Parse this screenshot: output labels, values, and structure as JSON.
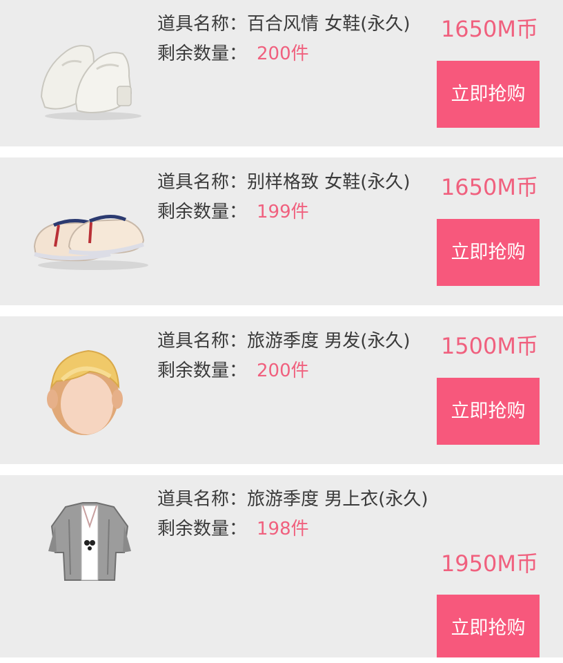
{
  "labels": {
    "name_prefix": "道具名称：",
    "stock_prefix": "剩余数量：",
    "buy_button": "立即抢购"
  },
  "colors": {
    "accent": "#f7587c",
    "price_text": "#f0607e",
    "card_bg": "#ececec"
  },
  "items": [
    {
      "name": "百合风情 女鞋(永久)",
      "stock": "200件",
      "price": "1650M币",
      "icon": "white-dress-shoes-icon"
    },
    {
      "name": "别样格致 女鞋(永久)",
      "stock": "199件",
      "price": "1650M币",
      "icon": "slip-on-shoes-icon"
    },
    {
      "name": "旅游季度 男发(永久)",
      "stock": "200件",
      "price": "1500M币",
      "icon": "blonde-hair-icon"
    },
    {
      "name": "旅游季度 男上衣(永久)",
      "stock": "198件",
      "price": "1950M币",
      "icon": "jacket-icon"
    }
  ]
}
